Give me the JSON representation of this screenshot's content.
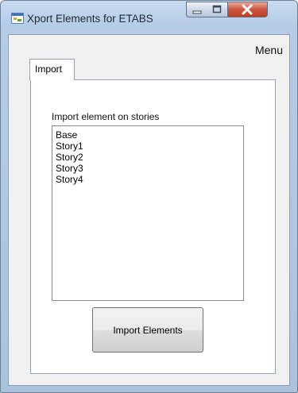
{
  "window": {
    "title": "Xport Elements for ETABS",
    "icon": "app-window-icon"
  },
  "menu": {
    "label": "Menu"
  },
  "tabs": [
    {
      "label": "Import",
      "selected": true
    }
  ],
  "import_panel": {
    "stories_label": "Import element on stories",
    "stories": [
      "Base",
      "Story1",
      "Story2",
      "Story3",
      "Story4"
    ],
    "import_button_label": "Import Elements"
  },
  "colors": {
    "close_button": "#c9432a",
    "frame": "#b4cce6"
  }
}
